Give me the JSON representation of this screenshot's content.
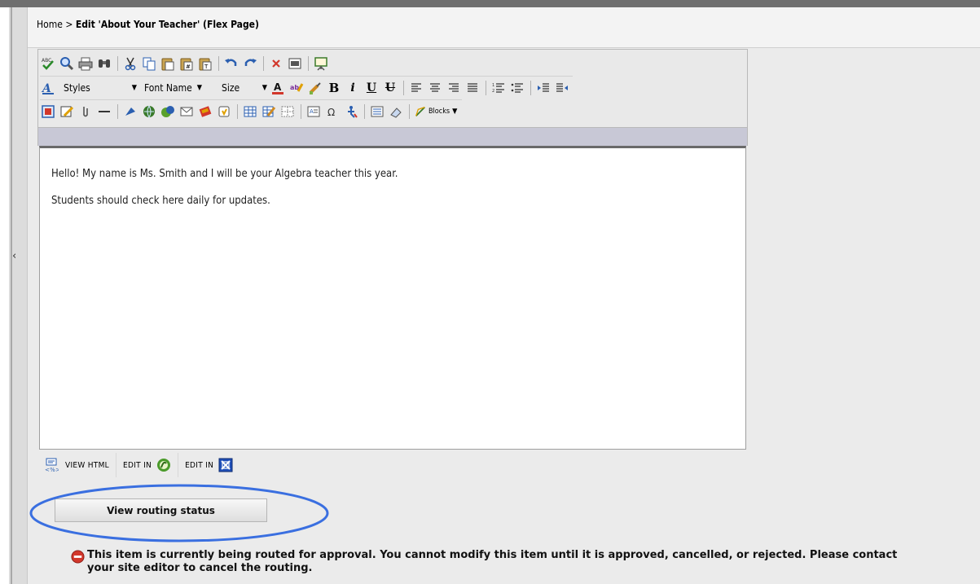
{
  "breadcrumb": {
    "home": "Home",
    "separator": ">",
    "current": "Edit 'About Your Teacher' (Flex Page)"
  },
  "toolbar": {
    "styles_label": "Styles",
    "fontname_label": "Font Name",
    "size_label": "Size",
    "blocks_label": "Blocks",
    "bold": "B",
    "italic": "i",
    "underline": "U",
    "strike": "U"
  },
  "content": {
    "paragraph1": "Hello! My name is Ms. Smith and I will be your Algebra teacher this year.",
    "paragraph2": "Students should check here daily for updates."
  },
  "editor_tabs": {
    "view_html": "VIEW HTML",
    "edit_in_1": "EDIT IN",
    "edit_in_2": "EDIT IN"
  },
  "routing": {
    "button_label": "View routing status",
    "warning_line1": "This item is currently being routed for approval. You cannot modify this item until it is approved, cancelled, or rejected. Please contact",
    "warning_line2": "your site editor to cancel the routing."
  },
  "colors": {
    "highlight": "#3a6fe0",
    "warning_icon": "#d2372b",
    "editor_bars": "#c8c8d6"
  }
}
